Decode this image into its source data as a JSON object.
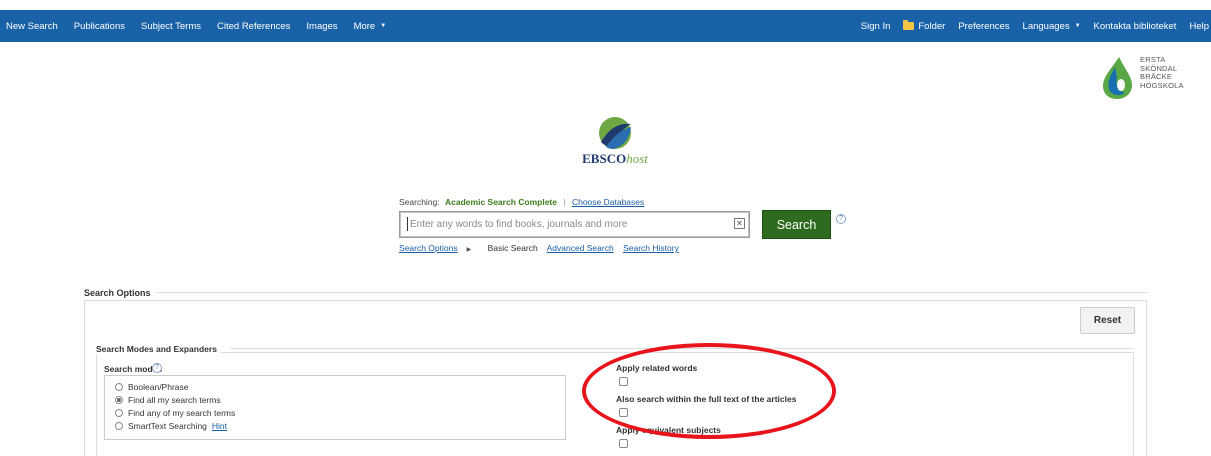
{
  "nav": {
    "left": [
      {
        "label": "New Search"
      },
      {
        "label": "Publications"
      },
      {
        "label": "Subject Terms"
      },
      {
        "label": "Cited References"
      },
      {
        "label": "Images"
      },
      {
        "label": "More"
      }
    ],
    "right": {
      "sign_in": "Sign In",
      "folder": "Folder",
      "preferences": "Preferences",
      "languages": "Languages",
      "contact": "Kontakta biblioteket",
      "help": "Help"
    }
  },
  "institution": {
    "lines": [
      "ERSTA",
      "SKÖNDAL",
      "BRÄCKE",
      "HÖGSKOLA"
    ],
    "colors": {
      "green": "#5aa845",
      "blue": "#1a6fb0"
    }
  },
  "brand": {
    "name_bold": "EBSCO",
    "name_italic": "host",
    "colors": {
      "navy": "#1f3b6e",
      "green": "#6fa843",
      "blue": "#2a6db0"
    }
  },
  "search": {
    "searching_label": "Searching:",
    "database": "Academic Search Complete",
    "choose_databases": "Choose Databases",
    "placeholder": "Enter any words to find books, journals and more",
    "value": "",
    "button": "Search",
    "clear_icon": "close-icon",
    "help_icon": "help-icon",
    "links": {
      "options": "Search Options",
      "basic": "Basic Search",
      "advanced": "Advanced Search",
      "history": "Search History"
    }
  },
  "options": {
    "title": "Search Options",
    "reset": "Reset",
    "section_title": "Search Modes and Expanders",
    "modes_label": "Search modes",
    "modes": [
      {
        "label": "Boolean/Phrase",
        "checked": false
      },
      {
        "label": "Find all my search terms",
        "checked": true
      },
      {
        "label": "Find any of my search terms",
        "checked": false
      },
      {
        "label": "SmartText Searching",
        "checked": false
      }
    ],
    "hint": "Hint",
    "expanders": [
      {
        "label": "Apply related words",
        "checked": false
      },
      {
        "label": "Also search within the full text of the articles",
        "checked": false
      },
      {
        "label": "Apply equivalent subjects",
        "checked": false
      }
    ]
  },
  "colors": {
    "topbar": "#1a62a8",
    "search_button": "#2f6b1f",
    "database_name": "#3e7d1d",
    "link": "#1a5ea8",
    "annotation": "#e8141c"
  }
}
